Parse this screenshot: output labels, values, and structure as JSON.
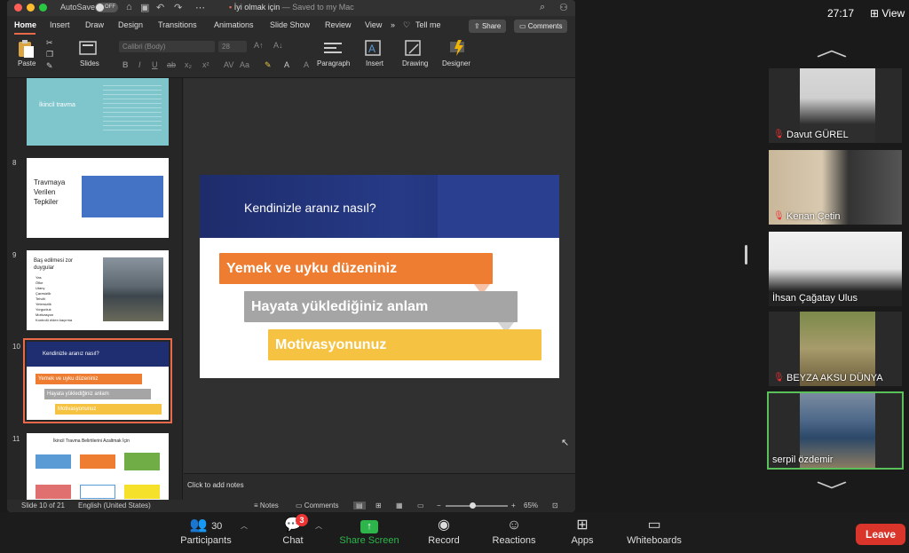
{
  "ppt": {
    "autosave_label": "AutoSave",
    "autosave_state": "OFF",
    "doc_title": "İyi olmak için",
    "doc_subtitle": " — Saved to my Mac",
    "menu": [
      "Home",
      "Insert",
      "Draw",
      "Design",
      "Transitions",
      "Animations",
      "Slide Show",
      "Review",
      "View"
    ],
    "tell_me": "Tell me",
    "share_label": "Share",
    "comments_label": "Comments",
    "ribbon": {
      "paste": "Paste",
      "slides": "Slides",
      "font_name": "Calibri (Body)",
      "font_size": "28",
      "paragraph": "Paragraph",
      "insert": "Insert",
      "drawing": "Drawing",
      "designer": "Designer"
    },
    "thumbs": [
      {
        "num": "",
        "title": "İkincil travma"
      },
      {
        "num": "8",
        "title": "Travmaya Verilen Tepkiler"
      },
      {
        "num": "9",
        "title": "Baş edilmesi zor duygular",
        "bullets": [
          "Yas",
          "Öfke",
          "Utanç",
          "Çaresizlik",
          "Tehdit",
          "Yetersizlik",
          "Yorgunluk",
          "Motivasyon",
          "Kontrolü elden kaçırma"
        ]
      },
      {
        "num": "10",
        "title": "Kendinizle aranız nasıl?"
      },
      {
        "num": "11",
        "title": "İkincil Travma Belirtilerini Azaltmak İçin"
      }
    ],
    "slide": {
      "title": "Kendinizle aranız nasıl?",
      "bars": [
        "Yemek ve uyku düzeniniz",
        "Hayata yüklediğiniz anlam",
        "Motivasyonunuz"
      ],
      "colors": [
        "#ee7d31",
        "#a5a5a5",
        "#f5c242"
      ]
    },
    "notes_placeholder": "Click to add notes",
    "status": {
      "slide_of": "Slide 10 of 21",
      "language": "English (United States)",
      "notes": "Notes",
      "comments": "Comments",
      "zoom": "65%"
    }
  },
  "zoom": {
    "timer": "27:17",
    "view": "View",
    "participants": [
      {
        "name": "Davut GÜREL",
        "muted": true
      },
      {
        "name": "Kenan Çetin",
        "muted": true
      },
      {
        "name": "İhsan Çağatay Ulus",
        "muted": false
      },
      {
        "name": "BEYZA AKSU DÜNYA",
        "muted": true
      },
      {
        "name": "serpil özdemir",
        "muted": false,
        "active": true
      }
    ],
    "toolbar": {
      "participants": "Participants",
      "participants_count": "30",
      "chat": "Chat",
      "chat_badge": "3",
      "share": "Share Screen",
      "record": "Record",
      "reactions": "Reactions",
      "apps": "Apps",
      "whiteboards": "Whiteboards",
      "leave": "Leave"
    }
  }
}
